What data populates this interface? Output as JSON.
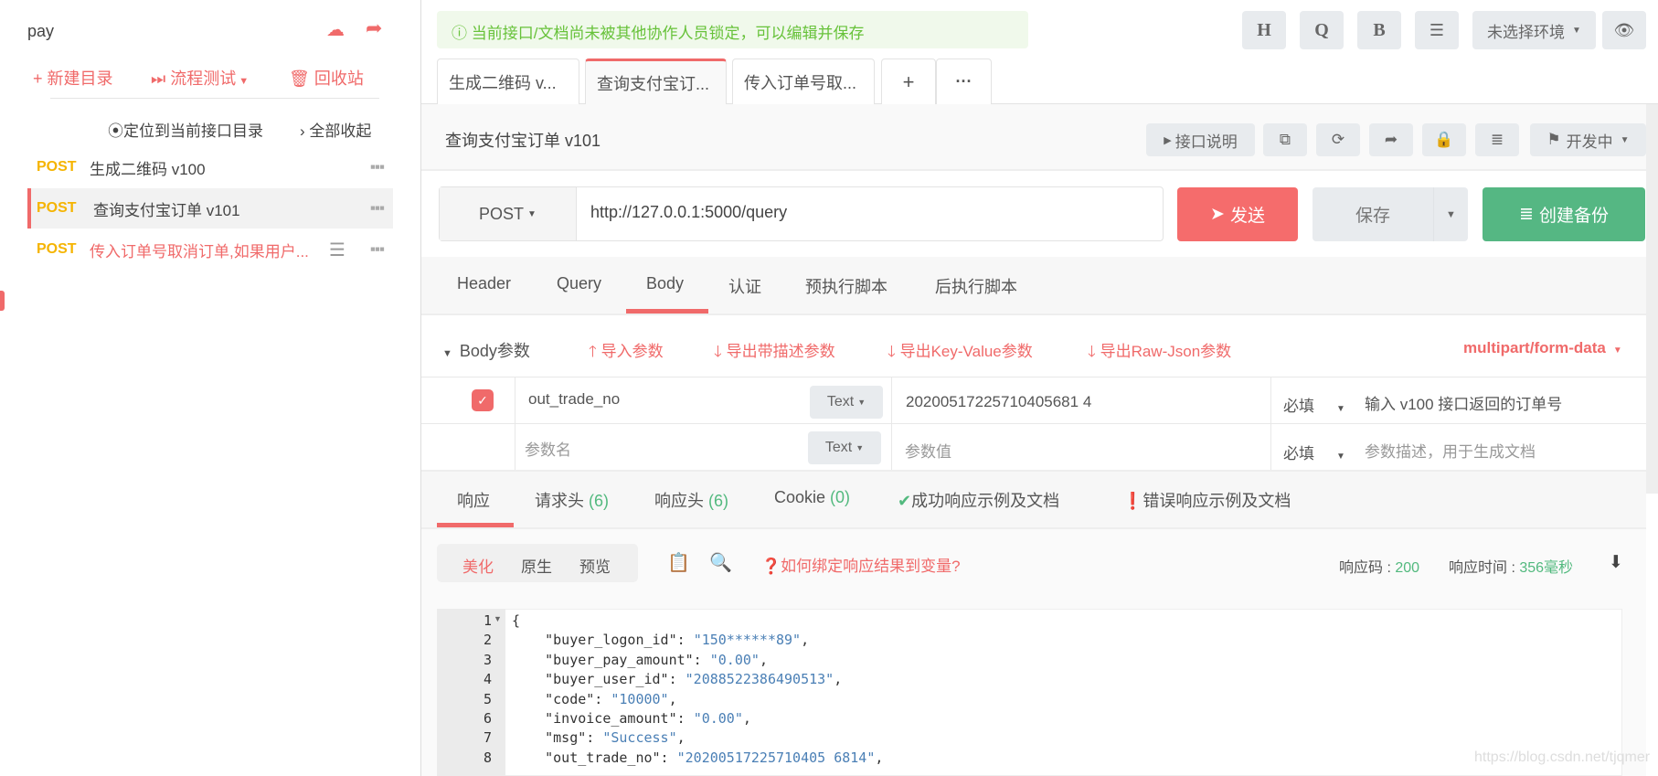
{
  "sidebar": {
    "project": "pay",
    "actions": {
      "new_dir": "新建目录",
      "flow_test": "流程测试",
      "recycle": "回收站"
    },
    "locate": "定位到当前接口目录",
    "collapse_all": "全部收起",
    "items": [
      {
        "method": "POST",
        "name": "生成二维码 v100"
      },
      {
        "method": "POST",
        "name": "查询支付宝订单 v101",
        "active": true
      },
      {
        "method": "POST",
        "name": "传入订单号取消订单,如果用户..."
      }
    ]
  },
  "notice": "当前接口/文档尚未被其他协作人员锁定，可以编辑并保存",
  "topbar": {
    "h": "H",
    "q": "Q",
    "b": "B",
    "env": "未选择环境"
  },
  "tabs": [
    {
      "label": "生成二维码 v..."
    },
    {
      "label": "查询支付宝订..."
    },
    {
      "label": "传入订单号取..."
    }
  ],
  "tab_add": "+",
  "tab_more": "···",
  "api": {
    "title": "查询支付宝订单 v101",
    "doc_button": "接口说明",
    "status": "开发中"
  },
  "request": {
    "method": "POST",
    "url": "http://127.0.0.1:5000/query",
    "send": "发送",
    "save": "保存",
    "backup": "创建备份"
  },
  "subtabs": [
    "Header",
    "Query",
    "Body",
    "认证",
    "预执行脚本",
    "后执行脚本"
  ],
  "body": {
    "label": "Body参数",
    "import": "导入参数",
    "export_desc": "导出带描述参数",
    "export_kv": "导出Key-Value参数",
    "export_json": "导出Raw-Json参数",
    "content_type": "multipart/form-data",
    "rows": [
      {
        "checked": true,
        "name": "out_trade_no",
        "type": "Text",
        "value": "20200517225710405681 4",
        "required": "必填",
        "desc": "输入 v100 接口返回的订单号"
      },
      {
        "checked": false,
        "name_placeholder": "参数名",
        "type": "Text",
        "value_placeholder": "参数值",
        "required": "必填",
        "desc_placeholder": "参数描述，用于生成文档"
      }
    ]
  },
  "response": {
    "tabs": [
      {
        "label": "响应"
      },
      {
        "label": "请求头",
        "count": "(6)"
      },
      {
        "label": "响应头",
        "count": "(6)"
      },
      {
        "label": "Cookie",
        "count": "(0)"
      },
      {
        "label": "成功响应示例及文档"
      },
      {
        "label": "错误响应示例及文档"
      }
    ],
    "views": [
      "美化",
      "原生",
      "预览"
    ],
    "bind_help": "如何绑定响应结果到变量?",
    "code_label": "响应码 : ",
    "code": "200",
    "time_label": "响应时间 : ",
    "time": "356毫秒",
    "lines": [
      {
        "n": "1",
        "k": "{",
        "v": ""
      },
      {
        "n": "2",
        "k": "    \"buyer_logon_id\": ",
        "v": "\"150******89\"",
        "e": ","
      },
      {
        "n": "3",
        "k": "    \"buyer_pay_amount\": ",
        "v": "\"0.00\"",
        "e": ","
      },
      {
        "n": "4",
        "k": "    \"buyer_user_id\": ",
        "v": "\"2088522386490513\"",
        "e": ","
      },
      {
        "n": "5",
        "k": "    \"code\": ",
        "v": "\"10000\"",
        "e": ","
      },
      {
        "n": "6",
        "k": "    \"invoice_amount\": ",
        "v": "\"0.00\"",
        "e": ","
      },
      {
        "n": "7",
        "k": "    \"msg\": ",
        "v": "\"Success\"",
        "e": ","
      },
      {
        "n": "8",
        "k": "    \"out_trade_no\": ",
        "v": "\"20200517225710405 6814\"",
        "e": ","
      }
    ]
  },
  "watermark": "https://blog.csdn.net/tjqmer",
  "colors": {
    "accent": "#f06a6a",
    "send": "#f56c6c",
    "backup": "#55b783",
    "method": "#f5b400",
    "notice_bg": "#f0f9eb",
    "notice_text": "#67c23a",
    "string": "#4a7fb5"
  }
}
